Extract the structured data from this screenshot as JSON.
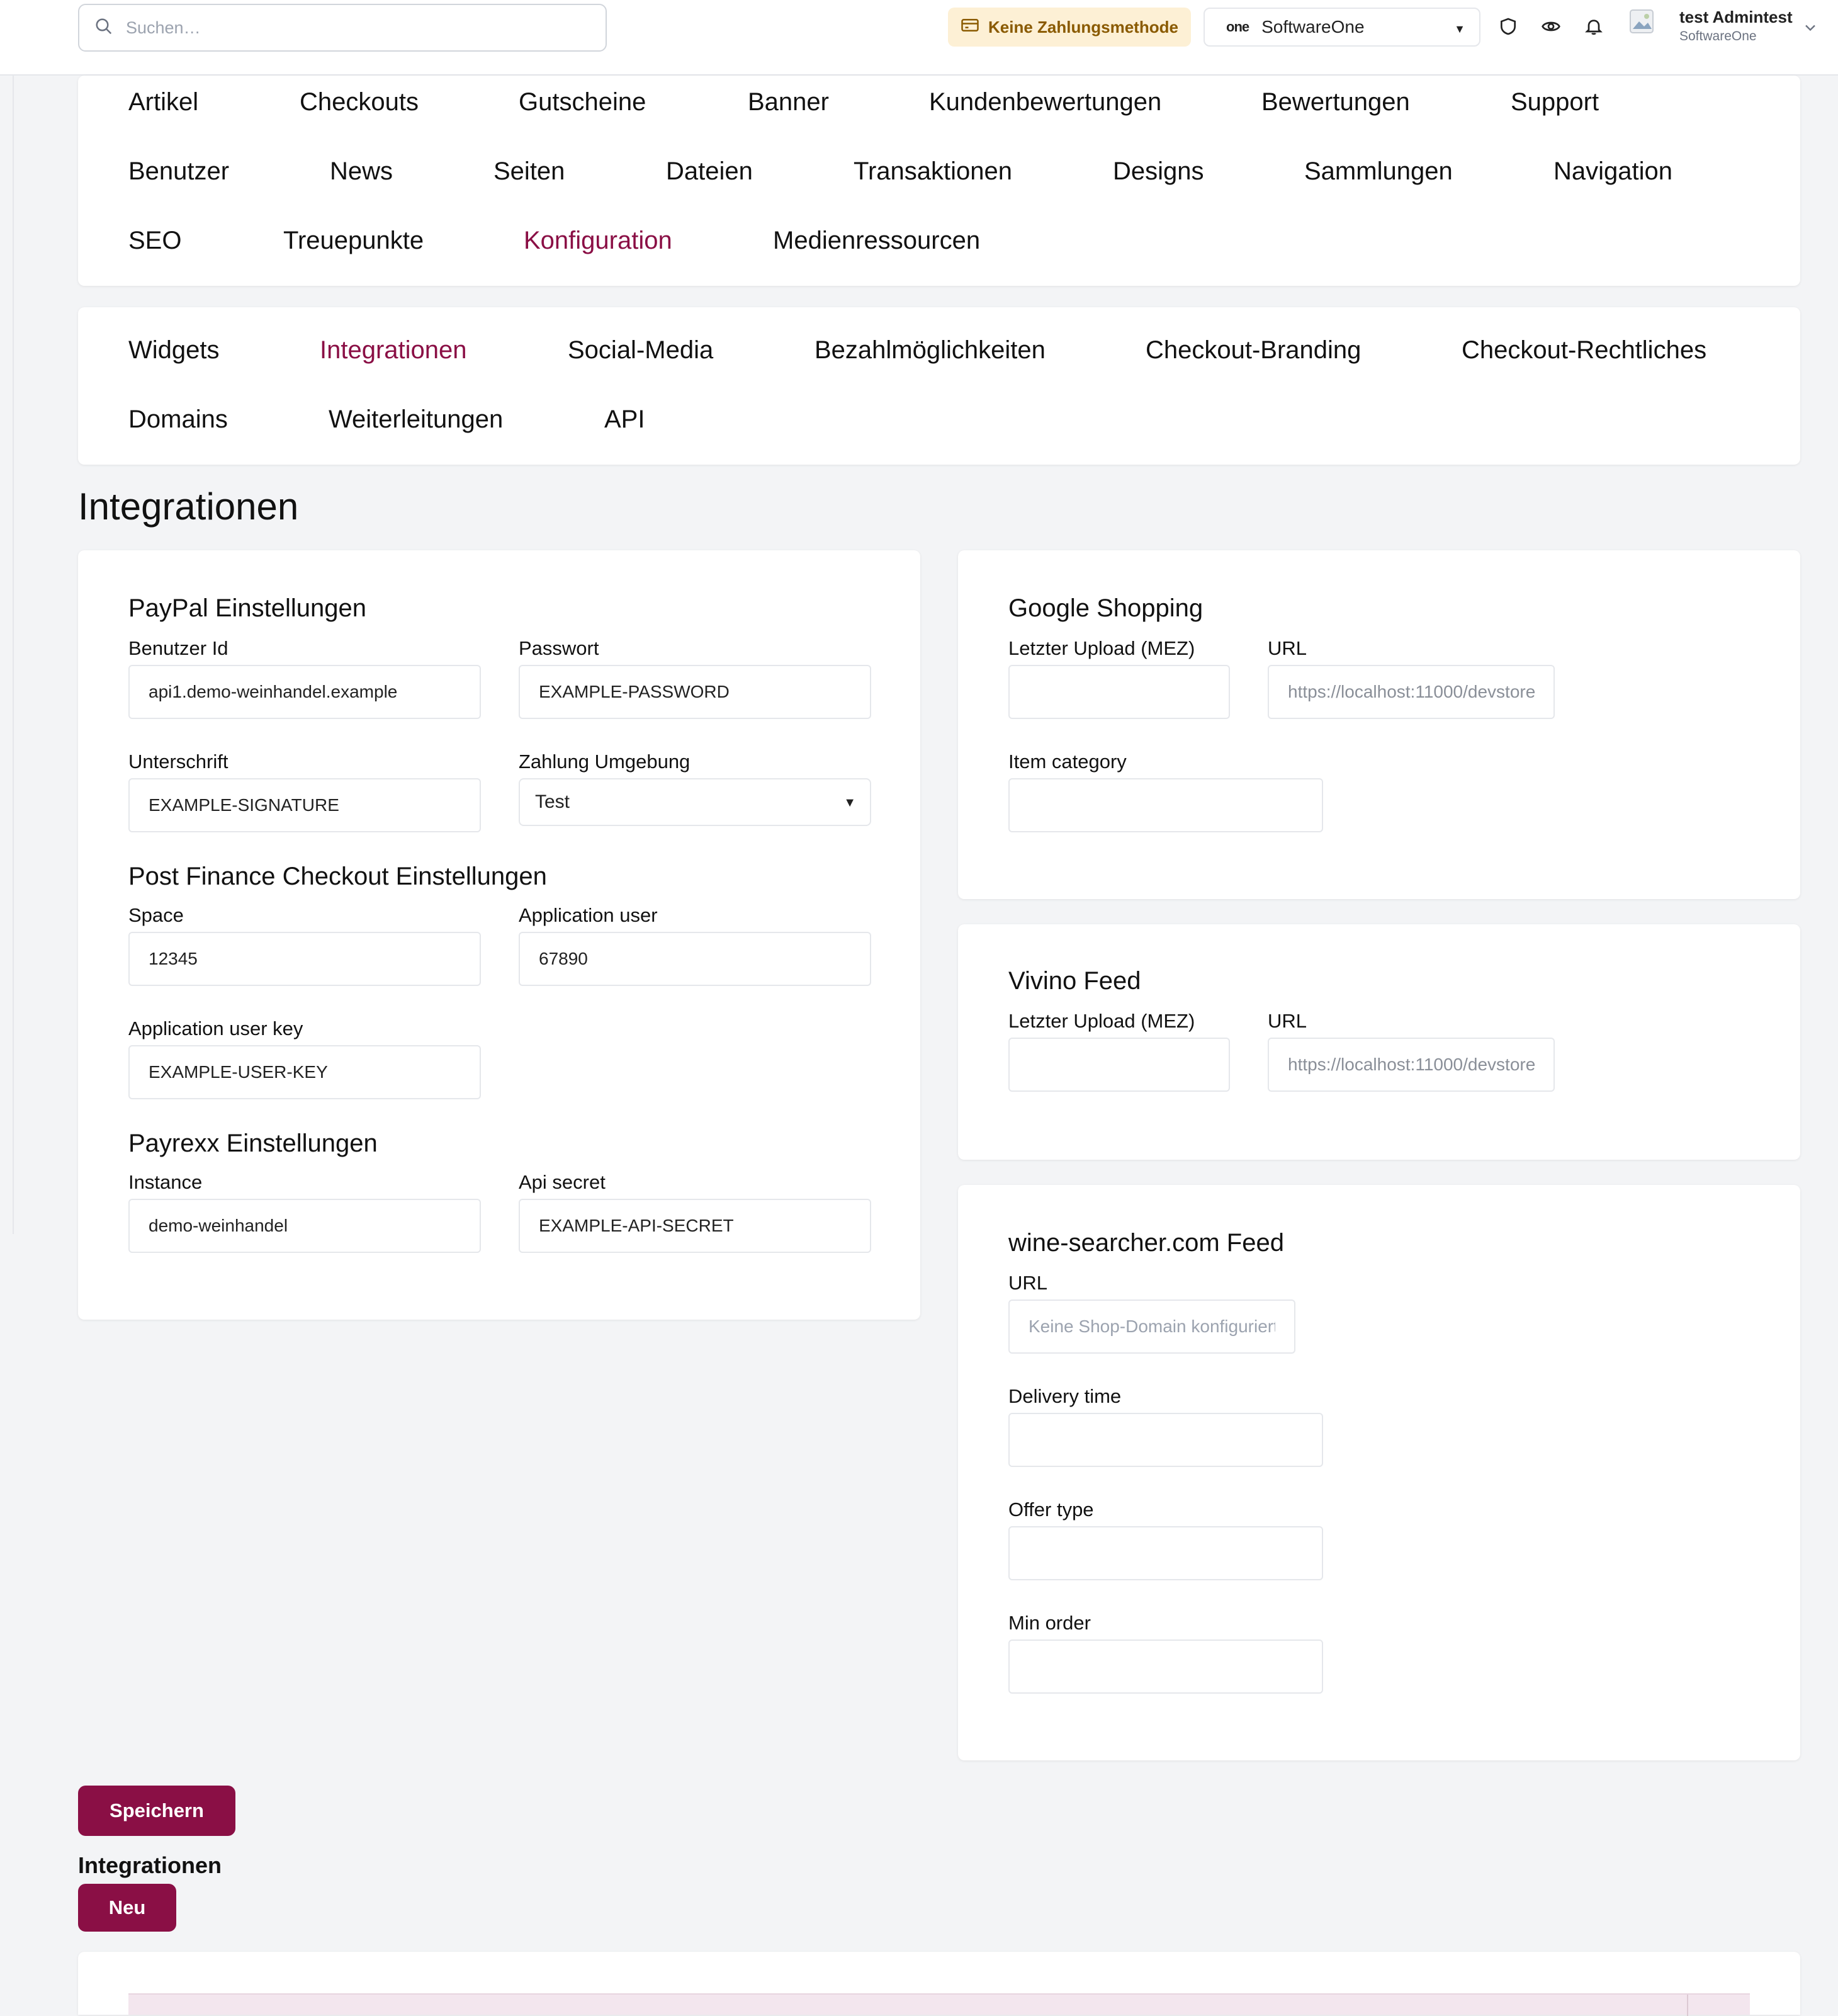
{
  "topbar": {
    "search_placeholder": "Suchen…",
    "payment_badge": "Keine Zahlungsmethode",
    "shop_logo": "one",
    "shop_name": "SoftwareOne",
    "user_name": "test Admintest",
    "user_org": "SoftwareOne"
  },
  "main_nav": {
    "row1": [
      {
        "label": "Artikel"
      },
      {
        "label": "Checkouts"
      },
      {
        "label": "Gutscheine"
      },
      {
        "label": "Banner"
      },
      {
        "label": "Kundenbewertungen"
      },
      {
        "label": "Bewertungen"
      },
      {
        "label": "Support"
      }
    ],
    "row2": [
      {
        "label": "Benutzer"
      },
      {
        "label": "News"
      },
      {
        "label": "Seiten"
      },
      {
        "label": "Dateien"
      },
      {
        "label": "Transaktionen"
      },
      {
        "label": "Designs"
      },
      {
        "label": "Sammlungen"
      },
      {
        "label": "Navigation"
      }
    ],
    "row3": [
      {
        "label": "SEO"
      },
      {
        "label": "Treuepunkte"
      },
      {
        "label": "Konfiguration",
        "active": true
      },
      {
        "label": "Medienressourcen"
      }
    ]
  },
  "sub_nav": {
    "row1": [
      {
        "label": "Widgets"
      },
      {
        "label": "Integrationen",
        "active": true
      },
      {
        "label": "Social-Media"
      },
      {
        "label": "Bezahlmöglichkeiten"
      },
      {
        "label": "Checkout-Branding"
      },
      {
        "label": "Checkout-Rechtliches"
      }
    ],
    "row2": [
      {
        "label": "Domains"
      },
      {
        "label": "Weiterleitungen"
      },
      {
        "label": "API"
      }
    ]
  },
  "page_title": "Integrationen",
  "paypal": {
    "title": "PayPal Einstellungen",
    "user_id_label": "Benutzer Id",
    "user_id_value": "api1.demo-weinhandel.example",
    "password_label": "Passwort",
    "password_value": "EXAMPLE-PASSWORD",
    "signature_label": "Unterschrift",
    "signature_value": "EXAMPLE-SIGNATURE",
    "environment_label": "Zahlung Umgebung",
    "environment_value": "Test"
  },
  "postfinance": {
    "title": "Post Finance Checkout Einstellungen",
    "space_label": "Space",
    "space_value": "12345",
    "app_user_label": "Application user",
    "app_user_value": "67890",
    "app_user_key_label": "Application user key",
    "app_user_key_value": "EXAMPLE-USER-KEY"
  },
  "payrexx": {
    "title": "Payrexx Einstellungen",
    "instance_label": "Instance",
    "instance_value": "demo-weinhandel",
    "api_secret_label": "Api secret",
    "api_secret_value": "EXAMPLE-API-SECRET"
  },
  "google_shopping": {
    "title": "Google Shopping",
    "last_upload_label": "Letzter Upload (MEZ)",
    "last_upload_value": "",
    "url_label": "URL",
    "url_value": "https://localhost:11000/devstore",
    "item_category_label": "Item category",
    "item_category_value": ""
  },
  "vivino": {
    "title": "Vivino Feed",
    "last_upload_label": "Letzter Upload (MEZ)",
    "last_upload_value": "",
    "url_label": "URL",
    "url_value": "https://localhost:11000/devstore"
  },
  "wine_searcher": {
    "title": "wine-searcher.com Feed",
    "url_label": "URL",
    "url_placeholder": "Keine Shop-Domain konfiguriert",
    "delivery_time_label": "Delivery time",
    "delivery_time_value": "",
    "offer_type_label": "Offer type",
    "offer_type_value": "",
    "min_order_label": "Min order",
    "min_order_value": ""
  },
  "actions": {
    "save_label": "Speichern",
    "integrations_heading": "Integrationen",
    "new_label": "Neu"
  },
  "colors": {
    "accent": "#8a0f45",
    "background": "#f3f4f6",
    "badge_bg": "#fdf0d5",
    "badge_text": "#8a5a00"
  }
}
